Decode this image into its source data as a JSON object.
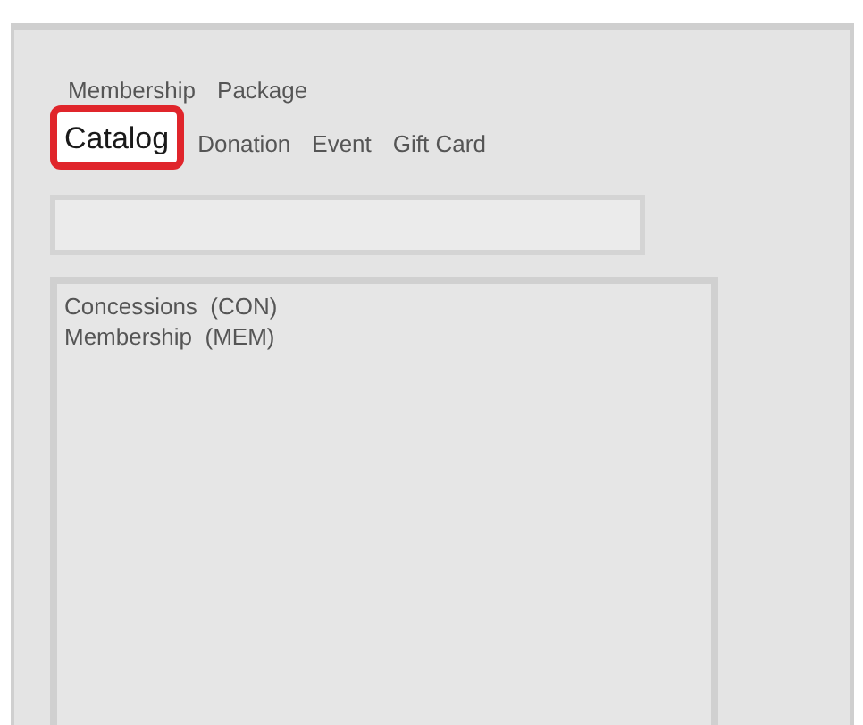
{
  "tab_rows": [
    {
      "tabs": [
        {
          "label": "Membership",
          "selected": false,
          "highlighted": false
        },
        {
          "label": "Package",
          "selected": false,
          "highlighted": false
        }
      ]
    },
    {
      "tabs": [
        {
          "label": "Catalog",
          "selected": true,
          "highlighted": true
        },
        {
          "label": "Donation",
          "selected": false,
          "highlighted": false
        },
        {
          "label": "Event",
          "selected": false,
          "highlighted": false
        },
        {
          "label": "Gift Card",
          "selected": false,
          "highlighted": false
        }
      ]
    }
  ],
  "list": {
    "items": [
      {
        "label": "Concessions  (CON)",
        "selected": false
      },
      {
        "label": "Membership  (MEM)",
        "selected": false
      }
    ]
  }
}
